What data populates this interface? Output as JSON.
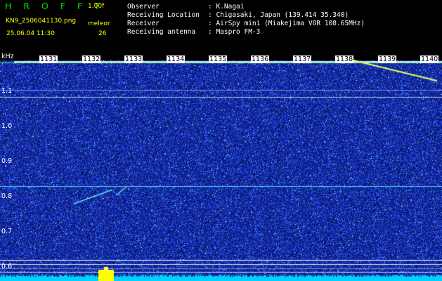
{
  "header": {
    "app_title": "H R O F F T",
    "version": "1.00f",
    "filename": "KN9_2506041130.png",
    "mode_label": "meleor",
    "mode_value": "26",
    "datetime": "25.06.04  11:30",
    "info": [
      {
        "label": "Observer",
        "value": ": K.Nagai"
      },
      {
        "label": "Receiving Location",
        "value": ": Chigasaki, Japan (139.414 35.340)"
      },
      {
        "label": "Receiver",
        "value": ": AirSpy mini (Miakejima VOR 108.65MHz)"
      },
      {
        "label": "Receiving antenna",
        "value": ": Maspro FM-3"
      }
    ]
  },
  "time_axis": {
    "labels": [
      "1131",
      "1132",
      "1133",
      "1134",
      "1135",
      "1136",
      "1137",
      "1138",
      "1139",
      "1140"
    ]
  },
  "freq_axis": {
    "unit": "kHz",
    "ticks": [
      "1.1",
      "1.0",
      "0.9",
      "0.8",
      "0.7",
      "0.6"
    ]
  },
  "colors": {
    "header_text": "#ffffff",
    "title": "#00e000",
    "accent": "#ffff00",
    "noise_background": "#0a1a78",
    "spectrum_bar": "#00d0ff"
  }
}
